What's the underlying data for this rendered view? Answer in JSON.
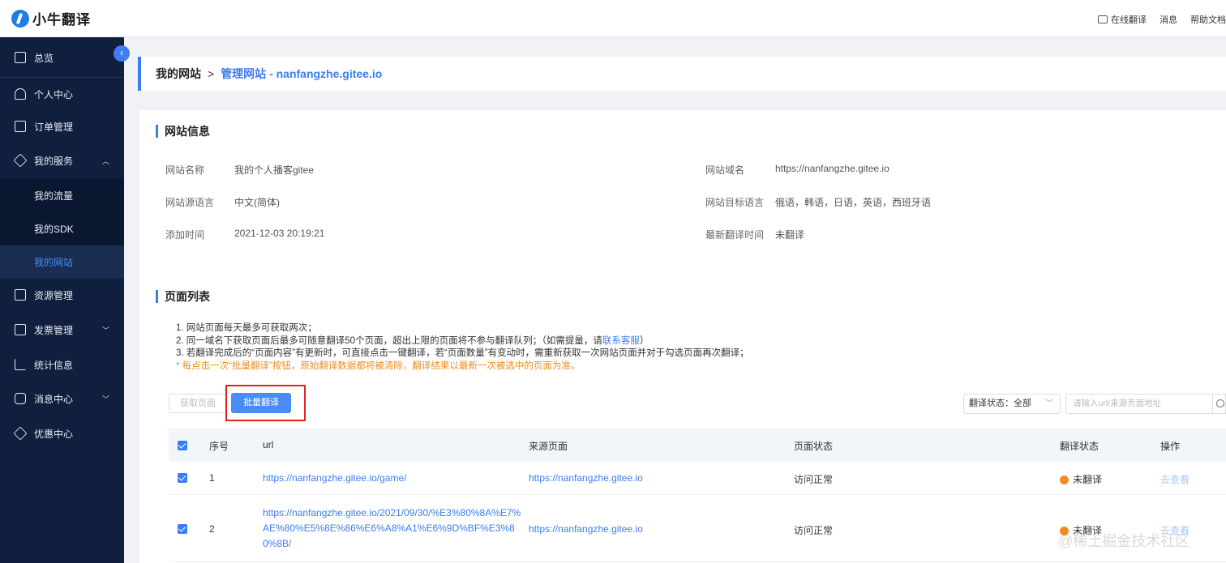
{
  "app": {
    "logo_text": "小牛翻译"
  },
  "header": {
    "links": [
      "在线翻译",
      "消息",
      "帮助文档"
    ]
  },
  "sidebar": {
    "items": [
      {
        "label": "总览",
        "icon": "grid-icon"
      },
      {
        "label": "个人中心",
        "icon": "user-icon"
      },
      {
        "label": "订单管理",
        "icon": "list-icon"
      },
      {
        "label": "我的服务",
        "icon": "box-icon",
        "expanded": true
      },
      {
        "label": "资源管理",
        "icon": "folder-icon"
      },
      {
        "label": "发票管理",
        "icon": "invoice-icon"
      },
      {
        "label": "统计信息",
        "icon": "chart-icon"
      },
      {
        "label": "消息中心",
        "icon": "message-icon"
      },
      {
        "label": "优惠中心",
        "icon": "tag-icon"
      }
    ],
    "sub_items": [
      "我的流量",
      "我的SDK",
      "我的网站"
    ],
    "active_sub": "我的网站"
  },
  "breadcrumb": {
    "parent": "我的网站",
    "separator": ">",
    "current": "管理网站 - nanfangzhe.gitee.io"
  },
  "site_info": {
    "title": "网站信息",
    "name_label": "网站名称",
    "name_value": "我的个人播客gitee",
    "domain_label": "网站域名",
    "domain_value": "https://nanfangzhe.gitee.io",
    "src_lang_label": "网站源语言",
    "src_lang_value": "中文(简体)",
    "tgt_lang_label": "网站目标语言",
    "tgt_lang_value": "俄语，韩语，日语，英语，西班牙语",
    "added_label": "添加时间",
    "added_value": "2021-12-03 20:19:21",
    "last_label": "最新翻译时间",
    "last_value": "未翻译"
  },
  "page_list": {
    "title": "页面列表",
    "note1": "1. 网站页面每天最多可获取两次；",
    "note2_a": "2. 同一域名下获取页面后最多可随意翻译50个页面，超出上限的页面将不参与翻译队列；（如需提量，请",
    "note2_link": "联系客服",
    "note2_b": "）",
    "note3": "3. 若翻译完成后的“页面内容”有更新时，可直接点击一键翻译，若“页面数量”有变动时，需重新获取一次网站页面并对于勾选页面再次翻译；",
    "warning": "* 每点击一次“批量翻译”按钮，原始翻译数据都将被清除，翻译结果以最新一次被选中的页面为准。",
    "fetch_btn": "获取页面",
    "batch_btn": "批量翻译",
    "status_filter": "翻译状态：全部",
    "search_placeholder": "请输入url/来源页面地址"
  },
  "table": {
    "columns": [
      "序号",
      "url",
      "来源页面",
      "页面状态",
      "翻译状态",
      "操作"
    ],
    "rows": [
      {
        "index": "1",
        "url_lines": [
          "https://nanfangzhe.gitee.io/game/"
        ],
        "source": "https://nanfangzhe.gitee.io",
        "page_status": "访问正常",
        "trans_status": "未翻译",
        "action": "去查看"
      },
      {
        "index": "2",
        "url_lines": [
          "https://nanfangzhe.gitee.io/2021/09/30/%E3%80%8A%E7%",
          "AE%80%E5%8E%86%E6%A8%A1%E6%9D%BF%E3%8",
          "0%8B/"
        ],
        "source": "https://nanfangzhe.gitee.io",
        "page_status": "访问正常",
        "trans_status": "未翻译",
        "action": "去查看"
      }
    ]
  },
  "watermark": "@稀土掘金技术社区",
  "colors": {
    "primary": "#3b7df0",
    "sidebar_bg": "#0f1f3d",
    "warning": "#f08c1e",
    "highlight_box": "#e02020"
  }
}
